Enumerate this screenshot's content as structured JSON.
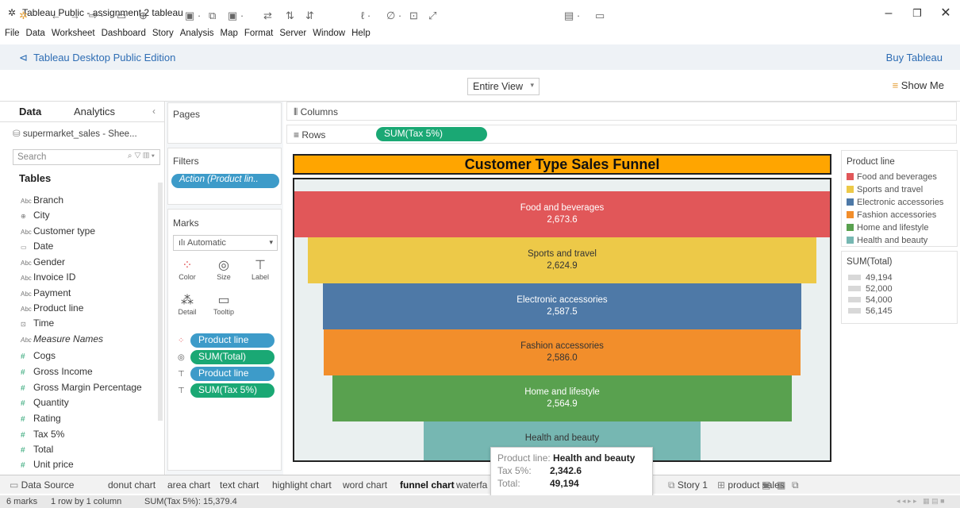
{
  "window": {
    "title": "Tableau Public - assignment 2 tableau"
  },
  "menu": [
    "File",
    "Data",
    "Worksheet",
    "Dashboard",
    "Story",
    "Analysis",
    "Map",
    "Format",
    "Server",
    "Window",
    "Help"
  ],
  "edition": {
    "label": "Tableau Desktop Public Edition",
    "buy": "Buy Tableau"
  },
  "toolbar": {
    "view_fit": "Entire View",
    "show_me": "Show Me"
  },
  "data_pane": {
    "tab_data": "Data",
    "tab_analytics": "Analytics",
    "datasource": "supermarket_sales - Shee...",
    "search_placeholder": "Search",
    "tables_label": "Tables",
    "fields": [
      {
        "icon": "Abc",
        "name": "Branch",
        "measure": false
      },
      {
        "icon": "⊕",
        "name": "City",
        "measure": false
      },
      {
        "icon": "Abc",
        "name": "Customer type",
        "measure": false
      },
      {
        "icon": "▭",
        "name": "Date",
        "measure": false
      },
      {
        "icon": "Abc",
        "name": "Gender",
        "measure": false
      },
      {
        "icon": "Abc",
        "name": "Invoice ID",
        "measure": false
      },
      {
        "icon": "Abc",
        "name": "Payment",
        "measure": false
      },
      {
        "icon": "Abc",
        "name": "Product line",
        "measure": false
      },
      {
        "icon": "⊡",
        "name": "Time",
        "measure": false
      },
      {
        "icon": "Abc",
        "name": "Measure Names",
        "measure": false
      },
      {
        "icon": "#",
        "name": "Cogs",
        "measure": true
      },
      {
        "icon": "#",
        "name": "Gross Income",
        "measure": true
      },
      {
        "icon": "#",
        "name": "Gross Margin Percentage",
        "measure": true
      },
      {
        "icon": "#",
        "name": "Quantity",
        "measure": true
      },
      {
        "icon": "#",
        "name": "Rating",
        "measure": true
      },
      {
        "icon": "#",
        "name": "Tax 5%",
        "measure": true
      },
      {
        "icon": "#",
        "name": "Total",
        "measure": true
      },
      {
        "icon": "#",
        "name": "Unit price",
        "measure": true
      }
    ]
  },
  "pages_label": "Pages",
  "filters": {
    "label": "Filters",
    "pill": "Action (Product lin.."
  },
  "marks": {
    "label": "Marks",
    "type": "Automatic",
    "buttons": [
      "Color",
      "Size",
      "Label",
      "Detail",
      "Tooltip"
    ],
    "pills": [
      "Product line",
      "SUM(Total)",
      "Product line",
      "SUM(Tax 5%)"
    ]
  },
  "shelves": {
    "columns": "Columns",
    "rows": "Rows",
    "rows_pill": "SUM(Tax 5%)"
  },
  "chart_data": {
    "type": "bar",
    "title": "Customer Type Sales Funnel",
    "orientation": "funnel",
    "categories": [
      "Food and beverages",
      "Sports and travel",
      "Electronic accessories",
      "Fashion accessories",
      "Home and lifestyle",
      "Health and beauty"
    ],
    "values": [
      2673.6,
      2624.9,
      2587.5,
      2586.0,
      2564.9,
      2342.6
    ],
    "value_labels": [
      "2,673.6",
      "2,624.9",
      "2,587.5",
      "2,586.0",
      "2,564.9",
      ""
    ],
    "size_by": "SUM(Total)",
    "colors": [
      "#e15759",
      "#edc948",
      "#4e79a7",
      "#f28e2b",
      "#59a14f",
      "#76b7b2"
    ]
  },
  "legend_color": {
    "title": "Product line",
    "items": [
      "Food and beverages",
      "Sports and travel",
      "Electronic accessories",
      "Fashion accessories",
      "Home and lifestyle",
      "Health and beauty"
    ]
  },
  "legend_size": {
    "title": "SUM(Total)",
    "items": [
      "49,194",
      "52,000",
      "54,000",
      "56,145"
    ]
  },
  "tooltip": {
    "product_line_label": "Product line:",
    "product_line_value": "Health and beauty",
    "tax_label": "Tax 5%:",
    "tax_value": "2,342.6",
    "total_label": "Total:",
    "total_value": "49,194"
  },
  "sheet_tabs": [
    "Data Source",
    "donut chart",
    "area chart",
    "text chart",
    "highlight chart",
    "word chart",
    "funnel chart",
    "waterfa",
    "Story 1",
    "product sales"
  ],
  "status": {
    "marks": "6 marks",
    "rows": "1 row by 1 column",
    "sum": "SUM(Tax 5%): 15,379.4"
  }
}
